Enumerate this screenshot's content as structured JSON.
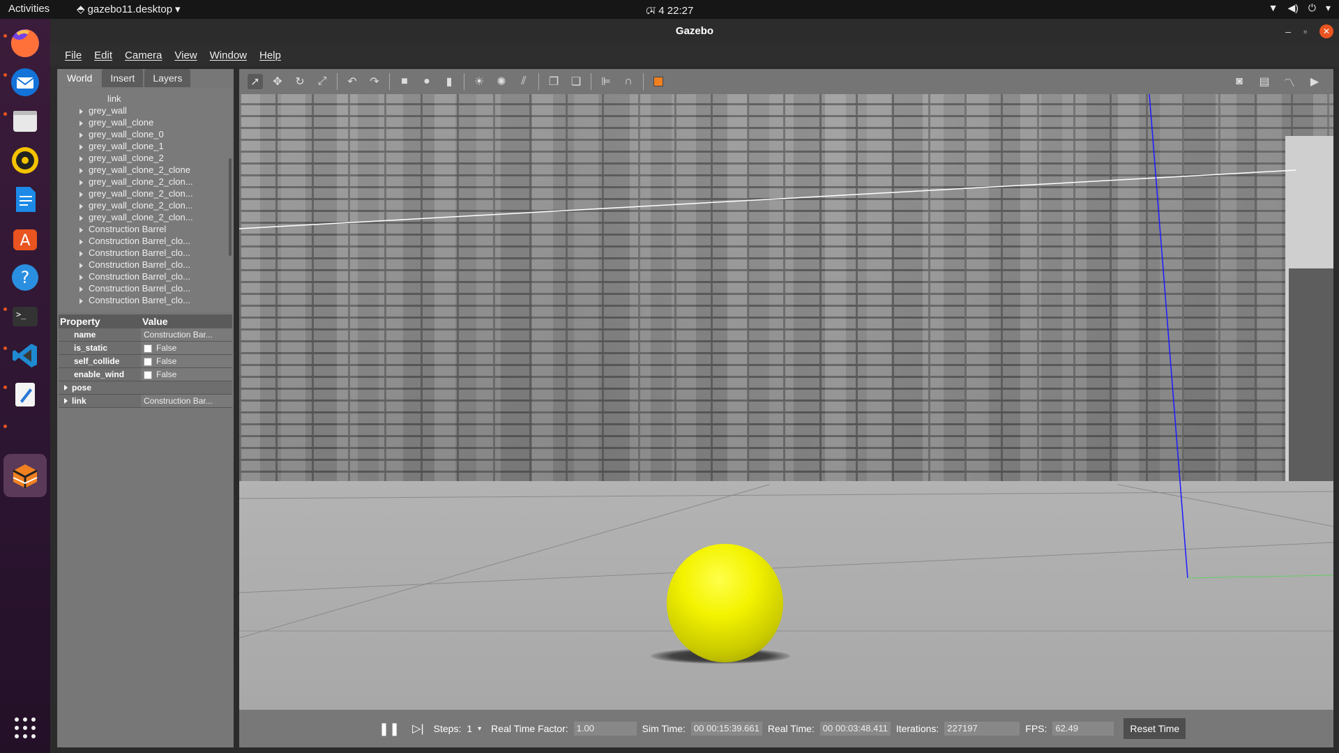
{
  "topbar": {
    "activities": "Activities",
    "app": "gazebo11.desktop",
    "clock": "মে 4  22:27"
  },
  "window": {
    "title": "Gazebo"
  },
  "menu": [
    "File",
    "Edit",
    "Camera",
    "View",
    "Window",
    "Help"
  ],
  "tabs": [
    "World",
    "Insert",
    "Layers"
  ],
  "tree": {
    "partial": "link",
    "items": [
      "grey_wall",
      "grey_wall_clone",
      "grey_wall_clone_0",
      "grey_wall_clone_1",
      "grey_wall_clone_2",
      "grey_wall_clone_2_clone",
      "grey_wall_clone_2_clon...",
      "grey_wall_clone_2_clon...",
      "grey_wall_clone_2_clon...",
      "grey_wall_clone_2_clon...",
      "Construction Barrel",
      "Construction Barrel_clo...",
      "Construction Barrel_clo...",
      "Construction Barrel_clo...",
      "Construction Barrel_clo...",
      "Construction Barrel_clo...",
      "Construction Barrel_clo..."
    ]
  },
  "props": {
    "h_property": "Property",
    "h_value": "Value",
    "rows": [
      {
        "k": "name",
        "v": "Construction Bar..."
      },
      {
        "k": "is_static",
        "v": "False",
        "checkbox": true
      },
      {
        "k": "self_collide",
        "v": "False",
        "checkbox": true
      },
      {
        "k": "enable_wind",
        "v": "False",
        "checkbox": true
      },
      {
        "k": "pose",
        "v": "",
        "expand": true
      },
      {
        "k": "link",
        "v": "Construction Bar...",
        "expand": true
      }
    ]
  },
  "status": {
    "steps_label": "Steps:",
    "steps": "1",
    "rtf_label": "Real Time Factor:",
    "rtf": "1.00",
    "sim_label": "Sim Time:",
    "sim": "00 00:15:39.661",
    "real_label": "Real Time:",
    "real": "00 00:03:48.411",
    "iter_label": "Iterations:",
    "iter": "227197",
    "fps_label": "FPS:",
    "fps": "62.49",
    "reset": "Reset Time"
  },
  "colors": {
    "accent": "#e95420",
    "ball": "#f3f300"
  }
}
